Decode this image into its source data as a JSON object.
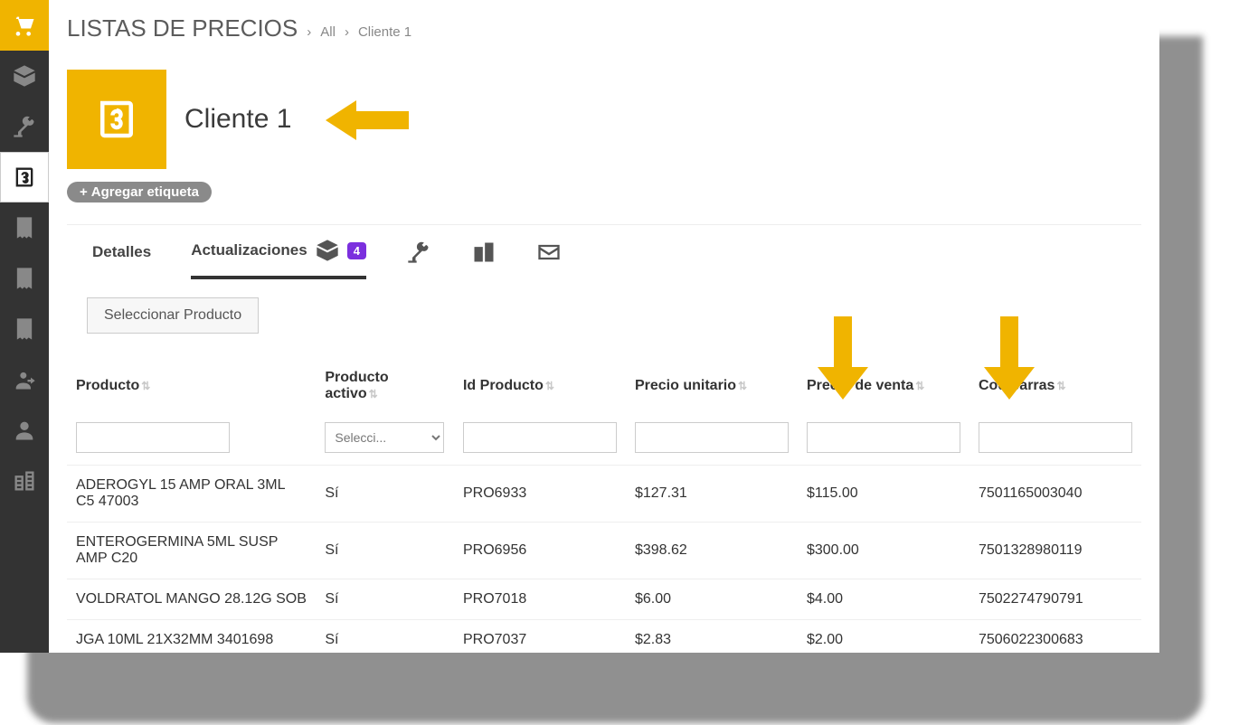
{
  "breadcrumb": {
    "title": "LISTAS DE PRECIOS",
    "level1": "All",
    "level2": "Cliente 1"
  },
  "header": {
    "client_title": "Cliente 1",
    "add_tag_label": "Agregar etiqueta"
  },
  "tabs": {
    "details": "Detalles",
    "updates": "Actualizaciones",
    "updates_badge": "4"
  },
  "actions": {
    "select_product": "Seleccionar Producto"
  },
  "table": {
    "headers": {
      "product": "Producto",
      "active": "Producto activo",
      "id": "Id Producto",
      "unit_price": "Precio unitario",
      "sale_price": "Precio de venta",
      "barcode": "Cod barras"
    },
    "filter_select_placeholder": "Selecci...",
    "rows": [
      {
        "product": "ADEROGYL 15 AMP ORAL 3ML C5 47003",
        "active": "Sí",
        "id": "PRO6933",
        "unit_price": "$127.31",
        "sale_price": "$115.00",
        "barcode": "7501165003040"
      },
      {
        "product": "ENTEROGERMINA 5ML SUSP AMP C20",
        "active": "Sí",
        "id": "PRO6956",
        "unit_price": "$398.62",
        "sale_price": "$300.00",
        "barcode": "7501328980119"
      },
      {
        "product": "VOLDRATOL MANGO 28.12G SOB",
        "active": "Sí",
        "id": "PRO7018",
        "unit_price": "$6.00",
        "sale_price": "$4.00",
        "barcode": "7502274790791"
      },
      {
        "product": "JGA 10ML 21X32MM 3401698",
        "active": "Sí",
        "id": "PRO7037",
        "unit_price": "$2.83",
        "sale_price": "$2.00",
        "barcode": "7506022300683"
      }
    ]
  },
  "colors": {
    "accent": "#f0b400",
    "badge": "#7b2fde"
  }
}
